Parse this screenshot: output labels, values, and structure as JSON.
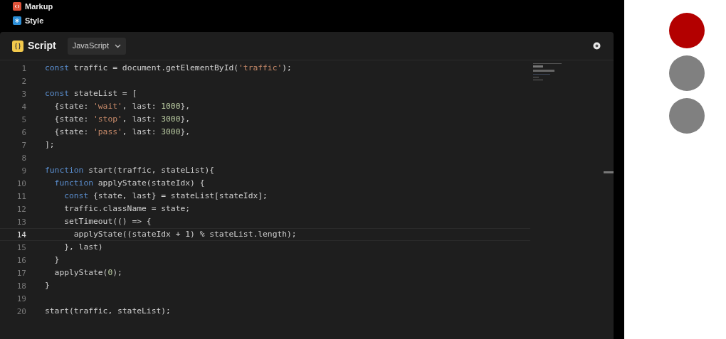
{
  "files": [
    {
      "label": "Markup",
      "kind": "markup"
    },
    {
      "label": "Style",
      "kind": "style"
    }
  ],
  "editor": {
    "title": "Script",
    "language": "JavaScript",
    "lines": [
      {
        "number": "1",
        "selected": false,
        "tokens": [
          {
            "kind": "keyword",
            "text": "const"
          },
          {
            "kind": "plain",
            "text": " traffic = document.getElementById("
          },
          {
            "kind": "string",
            "text": "'traffic'"
          },
          {
            "kind": "plain",
            "text": ");"
          }
        ]
      },
      {
        "number": "2",
        "selected": false
      },
      {
        "number": "3",
        "selected": false,
        "tokens": [
          {
            "kind": "keyword",
            "text": "const"
          },
          {
            "kind": "plain",
            "text": " stateList = ["
          }
        ]
      },
      {
        "number": "4",
        "selected": false,
        "tokens": [
          {
            "kind": "plain",
            "text": "  {state: "
          },
          {
            "kind": "string",
            "text": "'wait'"
          },
          {
            "kind": "plain",
            "text": ", last: "
          },
          {
            "kind": "number",
            "text": "1000"
          },
          {
            "kind": "plain",
            "text": "},"
          }
        ]
      },
      {
        "number": "5",
        "selected": false,
        "tokens": [
          {
            "kind": "plain",
            "text": "  {state: "
          },
          {
            "kind": "string",
            "text": "'stop'"
          },
          {
            "kind": "plain",
            "text": ", last: "
          },
          {
            "kind": "number",
            "text": "3000"
          },
          {
            "kind": "plain",
            "text": "},"
          }
        ]
      },
      {
        "number": "6",
        "selected": false,
        "tokens": [
          {
            "kind": "plain",
            "text": "  {state: "
          },
          {
            "kind": "string",
            "text": "'pass'"
          },
          {
            "kind": "plain",
            "text": ", last: "
          },
          {
            "kind": "number",
            "text": "3000"
          },
          {
            "kind": "plain",
            "text": "},"
          }
        ]
      },
      {
        "number": "7",
        "selected": false,
        "tokens": [
          {
            "kind": "plain",
            "text": "];"
          }
        ]
      },
      {
        "number": "8",
        "selected": false
      },
      {
        "number": "9",
        "selected": false,
        "tokens": [
          {
            "kind": "keyword",
            "text": "function"
          },
          {
            "kind": "plain",
            "text": " start(traffic, stateList){"
          }
        ]
      },
      {
        "number": "10",
        "selected": false,
        "tokens": [
          {
            "kind": "keyword",
            "text": "  function"
          },
          {
            "kind": "plain",
            "text": " applyState(stateIdx) {"
          }
        ]
      },
      {
        "number": "11",
        "selected": false,
        "tokens": [
          {
            "kind": "keyword",
            "text": "    const"
          },
          {
            "kind": "plain",
            "text": " {state, last} = stateList[stateIdx];"
          }
        ]
      },
      {
        "number": "12",
        "selected": false,
        "tokens": [
          {
            "kind": "plain",
            "text": "    traffic.className = state;"
          }
        ]
      },
      {
        "number": "13",
        "selected": false,
        "tokens": [
          {
            "kind": "plain",
            "text": "    setTimeout(() => {"
          }
        ]
      },
      {
        "number": "14",
        "selected": true,
        "tokens": [
          {
            "kind": "plain",
            "text": "      applyState((stateIdx + 1) % stateList.length);"
          }
        ]
      },
      {
        "number": "15",
        "selected": false,
        "tokens": [
          {
            "kind": "plain",
            "text": "    }, last)"
          }
        ]
      },
      {
        "number": "16",
        "selected": false,
        "tokens": [
          {
            "kind": "plain",
            "text": "  }"
          }
        ]
      },
      {
        "number": "17",
        "selected": false,
        "tokens": [
          {
            "kind": "plain",
            "text": "  applyState("
          },
          {
            "kind": "number",
            "text": "0"
          },
          {
            "kind": "plain",
            "text": ");"
          }
        ]
      },
      {
        "number": "18",
        "selected": false,
        "tokens": [
          {
            "kind": "plain",
            "text": "}"
          }
        ]
      },
      {
        "number": "19",
        "selected": false
      },
      {
        "number": "20",
        "selected": false,
        "tokens": [
          {
            "kind": "plain",
            "text": "start(traffic, stateList);"
          }
        ]
      }
    ]
  },
  "lights": [
    {
      "color": "#b30000"
    },
    {
      "color": "#808080"
    },
    {
      "color": "#808080"
    }
  ]
}
